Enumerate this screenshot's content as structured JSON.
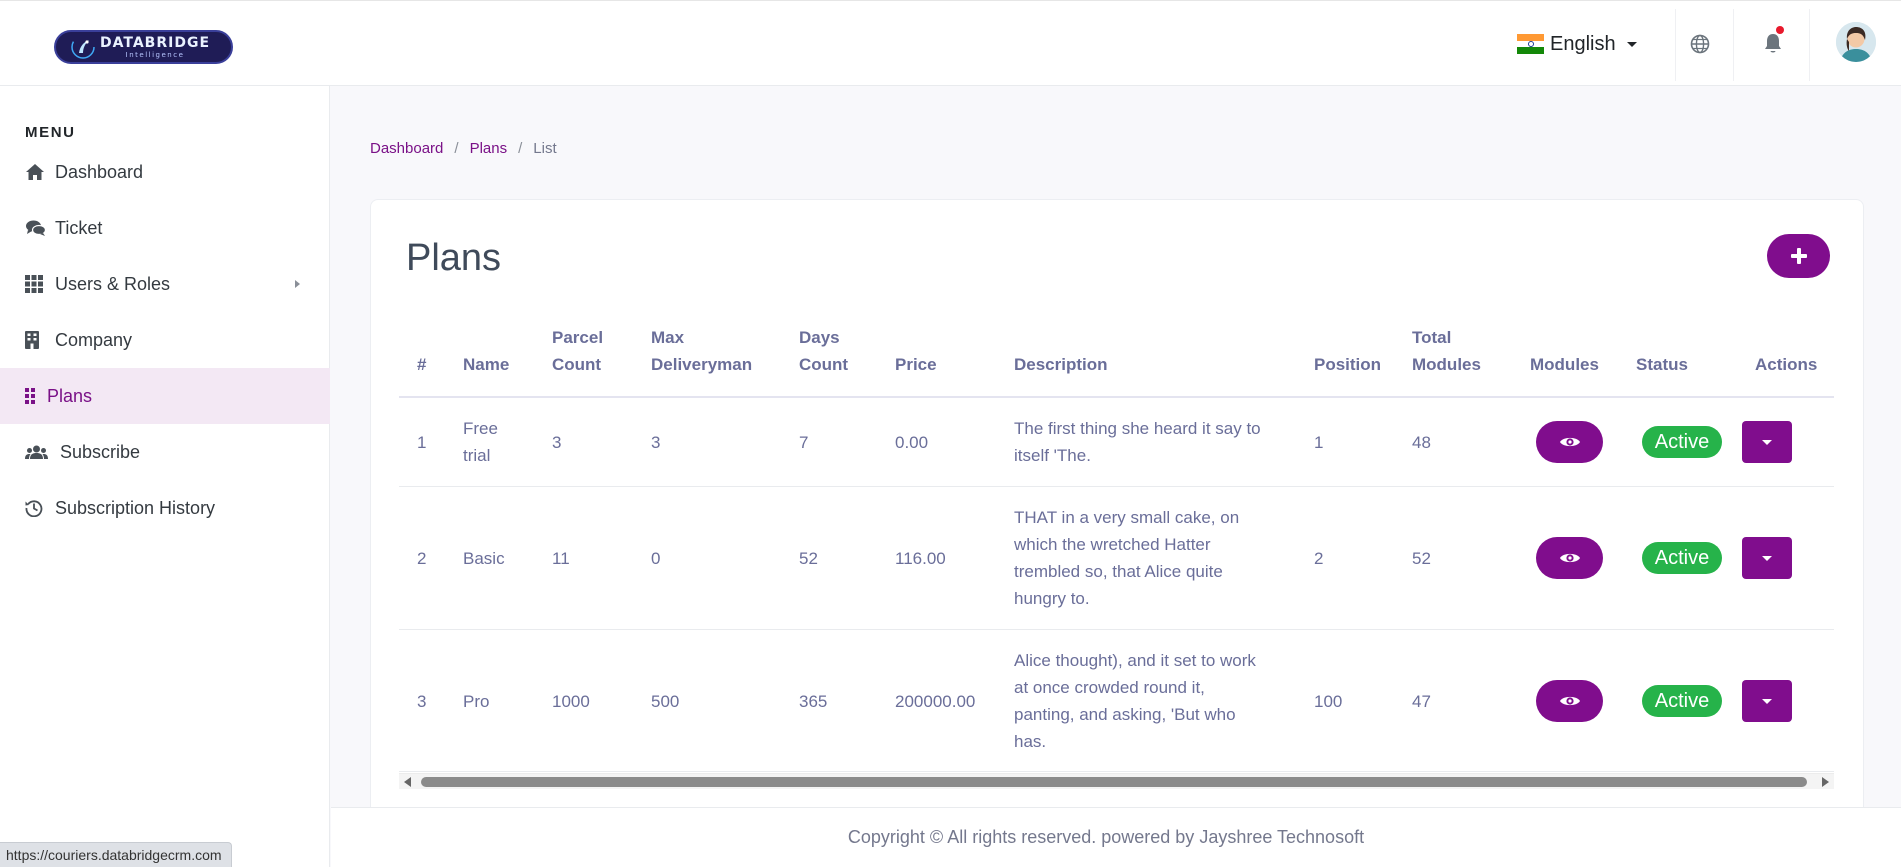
{
  "header": {
    "logo": {
      "name": "DATABRIDGE",
      "tagline": "Intelligence"
    },
    "language": {
      "label": "English",
      "flag": "india-flag"
    },
    "icons": [
      "globe-icon",
      "bell-icon",
      "user-avatar"
    ],
    "colors": {
      "brand": "#800d8d",
      "notification": "#e8192c"
    }
  },
  "sidebar": {
    "menu_title": "MENU",
    "items": [
      {
        "label": "Dashboard",
        "icon": "home-icon",
        "active": false
      },
      {
        "label": "Ticket",
        "icon": "comments-icon",
        "active": false
      },
      {
        "label": "Users & Roles",
        "icon": "grid-icon",
        "active": false,
        "has_submenu": true
      },
      {
        "label": "Company",
        "icon": "building-icon",
        "active": false
      },
      {
        "label": "Plans",
        "icon": "dots-grid-icon",
        "active": true
      },
      {
        "label": "Subscribe",
        "icon": "users-icon",
        "active": false
      },
      {
        "label": "Subscription History",
        "icon": "history-icon",
        "active": false
      }
    ]
  },
  "breadcrumb": {
    "items": [
      "Dashboard",
      "Plans"
    ],
    "current": "List"
  },
  "page": {
    "title": "Plans",
    "add_button_icon": "plus-icon"
  },
  "table": {
    "headers": {
      "num": "#",
      "name": "Name",
      "parcel": [
        "Parcel",
        "Count"
      ],
      "delivery": [
        "Max",
        "Deliveryman"
      ],
      "days": [
        "Days",
        "Count"
      ],
      "price": "Price",
      "description": "Description",
      "position": "Position",
      "total": [
        "Total",
        "Modules"
      ],
      "modules": "Modules",
      "status": "Status",
      "actions": "Actions"
    },
    "rows": [
      {
        "num": "1",
        "name": [
          "Free",
          "trial"
        ],
        "parcel": "3",
        "delivery": "3",
        "days": "7",
        "price": "0.00",
        "description": [
          "The first thing she heard it say to",
          "itself 'The."
        ],
        "position": "1",
        "total": "48",
        "status": "Active"
      },
      {
        "num": "2",
        "name": [
          "Basic"
        ],
        "parcel": "11",
        "delivery": "0",
        "days": "52",
        "price": "116.00",
        "description": [
          "THAT in a very small cake, on",
          "which the wretched Hatter",
          "trembled so, that Alice quite",
          "hungry to."
        ],
        "position": "2",
        "total": "52",
        "status": "Active"
      },
      {
        "num": "3",
        "name": [
          "Pro"
        ],
        "parcel": "1000",
        "delivery": "500",
        "days": "365",
        "price": "200000.00",
        "description": [
          "Alice thought), and it set to work",
          "at once crowded round it,",
          "panting, and asking, 'But who",
          "has."
        ],
        "position": "100",
        "total": "47",
        "status": "Active"
      }
    ]
  },
  "footer": {
    "text": "Copyright © All rights reserved. powered by Jayshree Technosoft"
  },
  "status_bar": {
    "url": "https://couriers.databridgecrm.com"
  }
}
